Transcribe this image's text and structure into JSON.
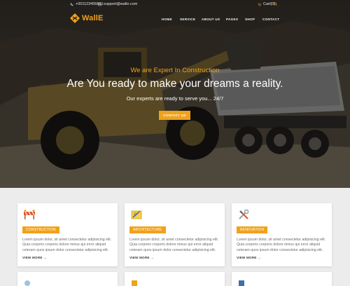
{
  "topbar": {
    "phone": "+001123456881",
    "email": "support@walle.com",
    "cart": "Cart(0)"
  },
  "brand": {
    "name": "WallE"
  },
  "nav": {
    "items": [
      "HOME",
      "SERVICE",
      "ABOUT US",
      "PAGES",
      "SHOP",
      "CONTACT"
    ]
  },
  "hero": {
    "tagline": "We are Expert In Construction",
    "title": "Are You ready to make your dreams a reality.",
    "subtitle": "Our experts are ready to serve you... 24/7",
    "cta": "CONTACT US"
  },
  "cards": [
    {
      "label": "CONSTRUCTION",
      "icon": "construction-barrier-icon",
      "desc": "Lorem ipsum dolor, sit amet consectetur adipisicing elit. Quia corporis corporis dolore minus qui error aliquid ceteram quos ipsum dolor consectetur adipisicing elit.",
      "more": "VIEW MORE"
    },
    {
      "label": "ARCHITECTURE",
      "icon": "drafting-icon",
      "desc": "Lorem ipsum dolor, sit amet consectetur adipisicing elit. Quia corporis corporis dolore minus qui error aliquid ceteram quos ipsum dolor consectetur adipisicing elit.",
      "more": "VIEW MORE"
    },
    {
      "label": "RENOVATION",
      "icon": "tools-icon",
      "desc": "Lorem ipsum dolor, sit amet consectetur adipisicing elit. Quia corporis corporis dolore minus qui error aliquid ceteram quos ipsum dolor consectetur adipisicing elit.",
      "more": "VIEW MORE"
    }
  ],
  "colors": {
    "accent": "#f0a21a",
    "background": "#ececec"
  }
}
